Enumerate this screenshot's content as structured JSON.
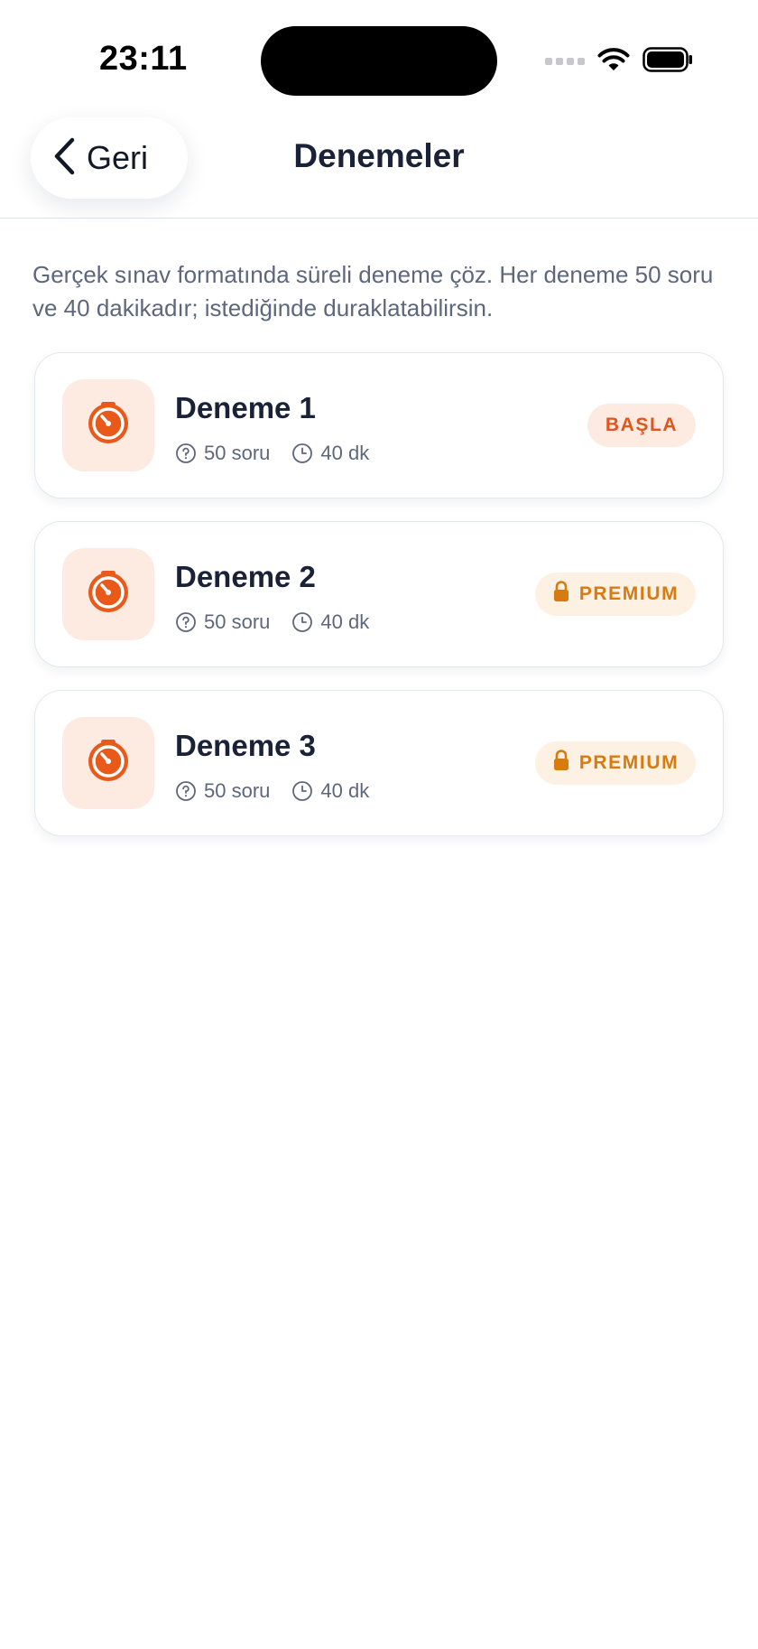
{
  "status_bar": {
    "time": "23:11"
  },
  "nav": {
    "back_label": "Geri",
    "title": "Denemeler"
  },
  "description": "Gerçek sınav formatında süreli deneme çöz. Her deneme 50 soru ve 40 dakikadır; istediğinde duraklatabilirsin.",
  "exams": [
    {
      "title": "Deneme 1",
      "questions": "50 soru",
      "duration": "40 dk",
      "badge": "BAŞLA",
      "locked": false,
      "icon": "timer-icon"
    },
    {
      "title": "Deneme 2",
      "questions": "50 soru",
      "duration": "40 dk",
      "badge": "PREMIUM",
      "locked": true,
      "icon": "timer-icon"
    },
    {
      "title": "Deneme 3",
      "questions": "50 soru",
      "duration": "40 dk",
      "badge": "PREMIUM",
      "locked": true,
      "icon": "timer-icon"
    }
  ],
  "colors": {
    "accent": "#e8591a",
    "accent_bg": "#fdebe2",
    "premium": "#d77a10",
    "premium_bg": "#fdf1e3",
    "title_text": "#1a2238",
    "muted_text": "#5d677c"
  }
}
